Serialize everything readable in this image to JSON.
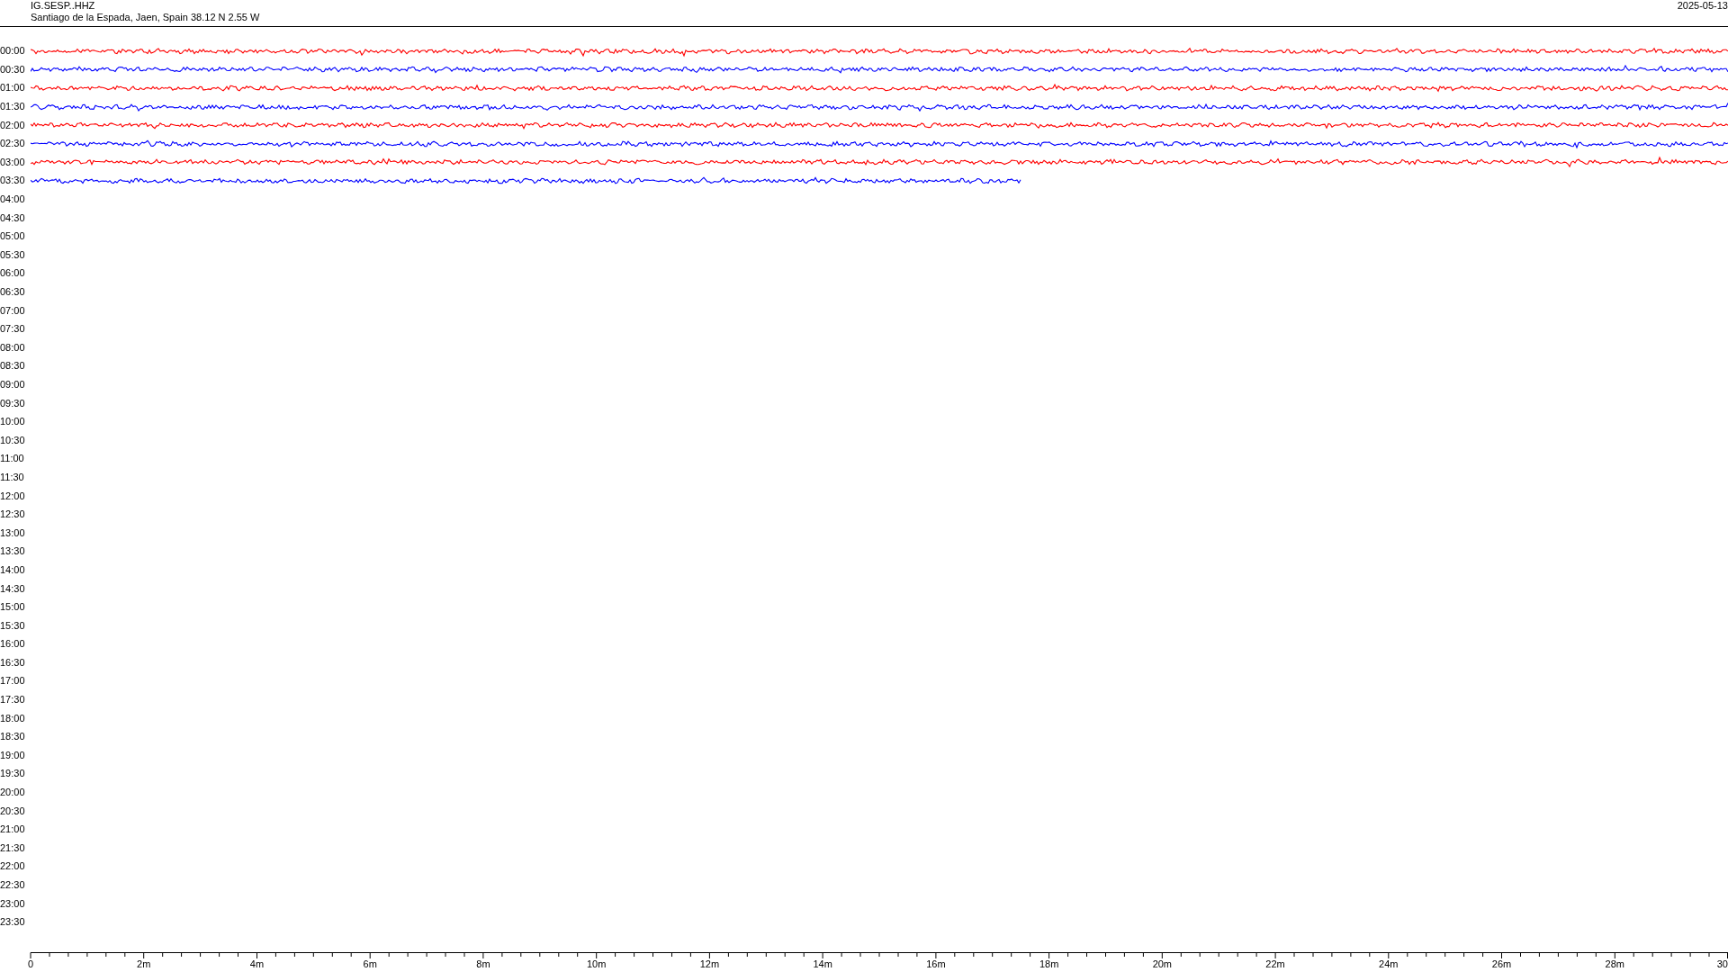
{
  "header": {
    "station": "IG.SESP..HHZ",
    "location": "Santiago de la Espada, Jaen, Spain  38.12 N 2.55 W",
    "date": "2025-05-13"
  },
  "rows": [
    {
      "label": "00:00",
      "color": "#ff0000",
      "level": 1
    },
    {
      "label": "00:30",
      "color": "#0000ff",
      "level": 1
    },
    {
      "label": "01:00",
      "color": "#ff0000",
      "level": 1
    },
    {
      "label": "01:30",
      "color": "#0000ff",
      "level": 1
    },
    {
      "label": "02:00",
      "color": "#ff0000",
      "level": 1
    },
    {
      "label": "02:30",
      "color": "#0000ff",
      "level": 1
    },
    {
      "label": "03:00",
      "color": "#ff0000",
      "level": 1
    },
    {
      "label": "03:30",
      "color": "#0000ff",
      "level": 0.584
    },
    {
      "label": "04:00"
    },
    {
      "label": "04:30"
    },
    {
      "label": "05:00"
    },
    {
      "label": "05:30"
    },
    {
      "label": "06:00"
    },
    {
      "label": "06:30"
    },
    {
      "label": "07:00"
    },
    {
      "label": "07:30"
    },
    {
      "label": "08:00"
    },
    {
      "label": "08:30"
    },
    {
      "label": "09:00"
    },
    {
      "label": "09:30"
    },
    {
      "label": "10:00"
    },
    {
      "label": "10:30"
    },
    {
      "label": "11:00"
    },
    {
      "label": "11:30"
    },
    {
      "label": "12:00"
    },
    {
      "label": "12:30"
    },
    {
      "label": "13:00"
    },
    {
      "label": "13:30"
    },
    {
      "label": "14:00"
    },
    {
      "label": "14:30"
    },
    {
      "label": "15:00"
    },
    {
      "label": "15:30"
    },
    {
      "label": "16:00"
    },
    {
      "label": "16:30"
    },
    {
      "label": "17:00"
    },
    {
      "label": "17:30"
    },
    {
      "label": "18:00"
    },
    {
      "label": "18:30"
    },
    {
      "label": "19:00"
    },
    {
      "label": "19:30"
    },
    {
      "label": "20:00"
    },
    {
      "label": "20:30"
    },
    {
      "label": "21:00"
    },
    {
      "label": "21:30"
    },
    {
      "label": "22:00"
    },
    {
      "label": "22:30"
    },
    {
      "label": "23:00"
    },
    {
      "label": "23:30"
    }
  ],
  "time_axis": {
    "ticks": [
      "0",
      "2m",
      "4m",
      "6m",
      "8m",
      "10m",
      "12m",
      "14m",
      "16m",
      "18m",
      "20m",
      "22m",
      "24m",
      "26m",
      "28m",
      "30"
    ]
  }
}
